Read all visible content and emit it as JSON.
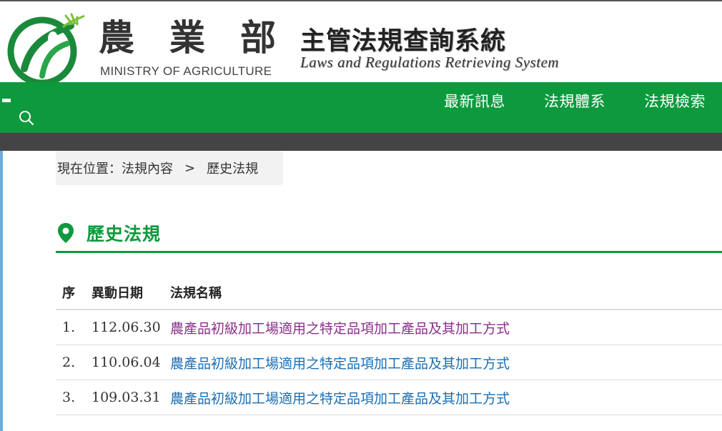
{
  "header": {
    "ministry_cn": [
      "農",
      "業",
      "部"
    ],
    "ministry_en": "MINISTRY OF AGRICULTURE",
    "system_cn": "主管法規查詢系統",
    "system_en": "Laws and Regulations Retrieving System",
    "logo_icon": "moa-leaf-logo-icon"
  },
  "nav": {
    "items": [
      {
        "label": "最新訊息"
      },
      {
        "label": "法規體系"
      },
      {
        "label": "法規檢索"
      }
    ],
    "search_icon": "search-icon"
  },
  "breadcrumb": {
    "prefix": "現在位置：法規內容",
    "separator": ">",
    "current": "歷史法規"
  },
  "section": {
    "title": "歷史法規",
    "icon": "map-pin-icon"
  },
  "table": {
    "headers": {
      "seq": "序",
      "date": "異動日期",
      "name": "法規名稱"
    },
    "rows": [
      {
        "seq": "1.",
        "date": "112.06.30",
        "name": "農產品初級加工場適用之特定品項加工產品及其加工方式",
        "visited": true
      },
      {
        "seq": "2.",
        "date": "110.06.04",
        "name": "農產品初級加工場適用之特定品項加工產品及其加工方式",
        "visited": false
      },
      {
        "seq": "3.",
        "date": "109.03.31",
        "name": "農產品初級加工場適用之特定品項加工產品及其加工方式",
        "visited": false
      }
    ]
  },
  "colors": {
    "brand_green": "#0d9a3d",
    "dark_bar": "#444444",
    "link": "#1a6fb5",
    "link_visited": "#8b2f8b"
  }
}
